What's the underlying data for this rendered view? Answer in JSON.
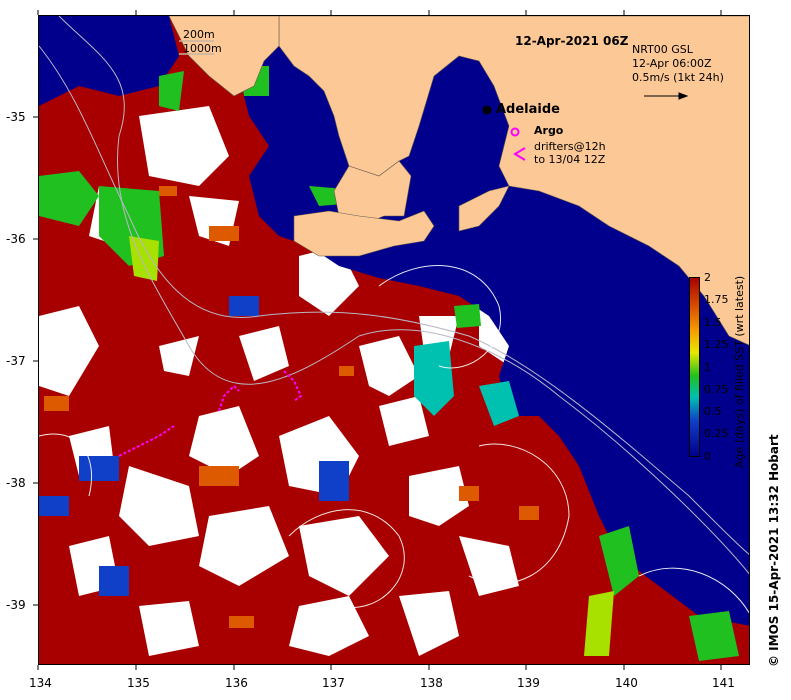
{
  "map": {
    "title": "12-Apr-2021 06Z",
    "product": {
      "line1": "NRT00 GSL",
      "line2": "12-Apr 06:00Z",
      "line3": "0.5m/s (1kt 24h)"
    },
    "depth_contours": [
      "200m",
      "1000m"
    ],
    "city": "Adelaide",
    "legend": {
      "argo": "Argo",
      "drifters_line1": "drifters@12h",
      "drifters_line2": "to 13/04 12Z"
    },
    "colorbar": {
      "label": "Age (days) of filled SST (wrt latest)",
      "ticks": [
        "2",
        "1.75",
        "1.5",
        "1.25",
        "1",
        "0.75",
        "0.5",
        "0.25",
        "0"
      ]
    },
    "x_axis_ticks": [
      "134",
      "135",
      "136",
      "137",
      "138",
      "139",
      "140",
      "141"
    ],
    "y_axis_ticks": [
      "-35",
      "-36",
      "-37",
      "-38",
      "-39"
    ],
    "credit": "© IMOS 15-Apr-2021 13:32 Hobart",
    "colors": {
      "land": "#fcc896",
      "ocean_recent": "#00008c",
      "age_2_days": "#a80000",
      "cloud_gap": "#ffffff",
      "argo": "#ff00ff"
    }
  }
}
